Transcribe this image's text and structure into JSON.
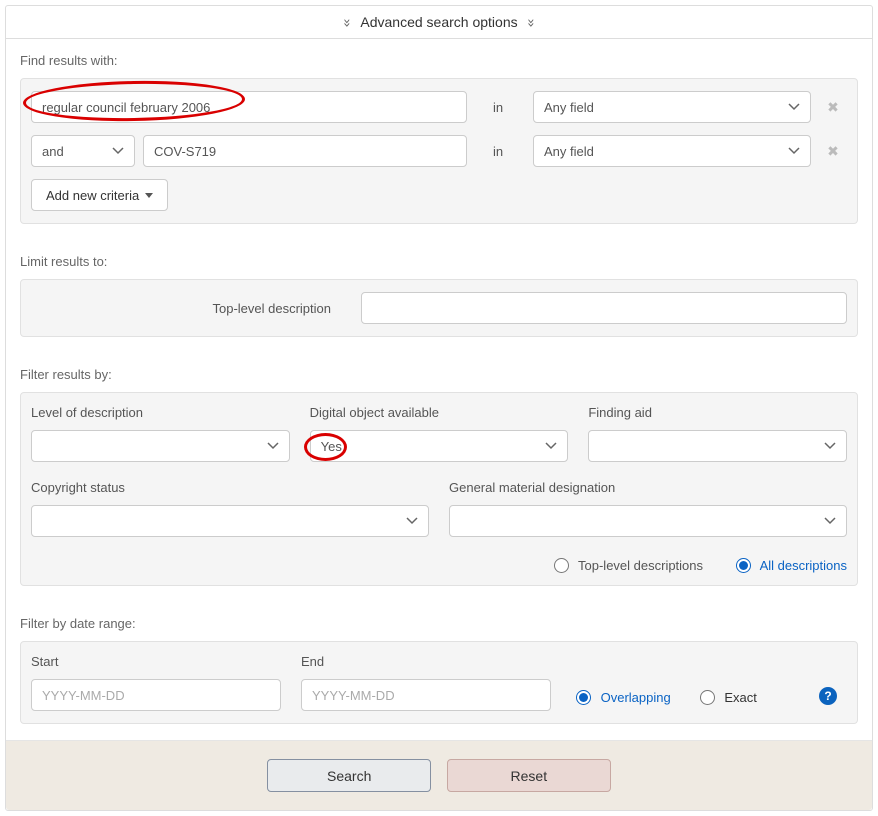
{
  "header": {
    "title": "Advanced search options"
  },
  "find": {
    "label": "Find results with:",
    "rows": [
      {
        "value": "regular council february 2006",
        "in": "in",
        "field": "Any field"
      },
      {
        "op": "and",
        "value": "COV-S719",
        "in": "in",
        "field": "Any field"
      }
    ],
    "add": "Add new criteria"
  },
  "limit": {
    "label": "Limit results to:",
    "top_level": "Top-level description"
  },
  "filter": {
    "label": "Filter results by:",
    "level": "Level of description",
    "digital": "Digital object available",
    "digital_value": "Yes",
    "finding": "Finding aid",
    "copyright": "Copyright status",
    "material": "General material designation",
    "radio_top": "Top-level descriptions",
    "radio_all": "All descriptions"
  },
  "date": {
    "label": "Filter by date range:",
    "start": "Start",
    "end": "End",
    "placeholder": "YYYY-MM-DD",
    "overlapping": "Overlapping",
    "exact": "Exact"
  },
  "footer": {
    "search": "Search",
    "reset": "Reset"
  }
}
